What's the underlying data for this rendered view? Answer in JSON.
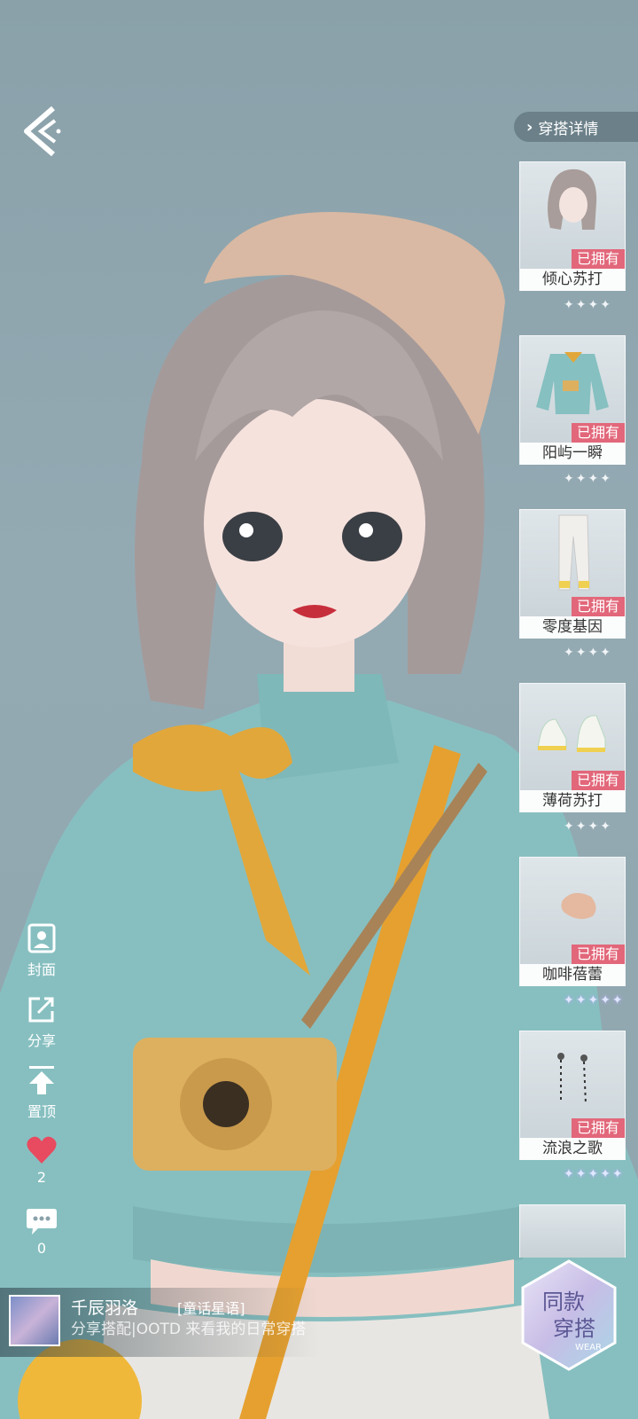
{
  "colors": {
    "owned_badge": "#e2677a",
    "sweater": "#86c0c1",
    "scarf": "#e2a73a",
    "accent_heart": "#e84a5f"
  },
  "header": {
    "back_icon": "back-arrow-icon",
    "detail_label": "穿搭详情"
  },
  "items": [
    {
      "name": "倾心苏打",
      "badge": "已拥有",
      "stars": "✦✦✦✦",
      "icon": "hair-icon"
    },
    {
      "name": "阳屿一瞬",
      "badge": "已拥有",
      "stars": "✦✦✦✦",
      "icon": "sweater-icon"
    },
    {
      "name": "零度基因",
      "badge": "已拥有",
      "stars": "✦✦✦✦",
      "icon": "pants-icon"
    },
    {
      "name": "薄荷苏打",
      "badge": "已拥有",
      "stars": "✦✦✦✦",
      "icon": "shoes-icon"
    },
    {
      "name": "咖啡蓓蕾",
      "badge": "已拥有",
      "stars": "✦✦✦✦✦",
      "icon": "beret-icon"
    },
    {
      "name": "流浪之歌",
      "badge": "已拥有",
      "stars": "✦✦✦✦✦",
      "icon": "earrings-icon"
    }
  ],
  "actions": {
    "cover_label": "封面",
    "share_label": "分享",
    "pin_label": "置顶",
    "likes": "2",
    "comments": "0"
  },
  "author": {
    "name": "千辰羽洛",
    "tag": "[童话星语]",
    "desc": "分享搭配|OOTD 来看我的日常穿搭"
  },
  "same_outfit": {
    "line1": "同款",
    "line2": "穿搭",
    "sub": "WEAR"
  }
}
